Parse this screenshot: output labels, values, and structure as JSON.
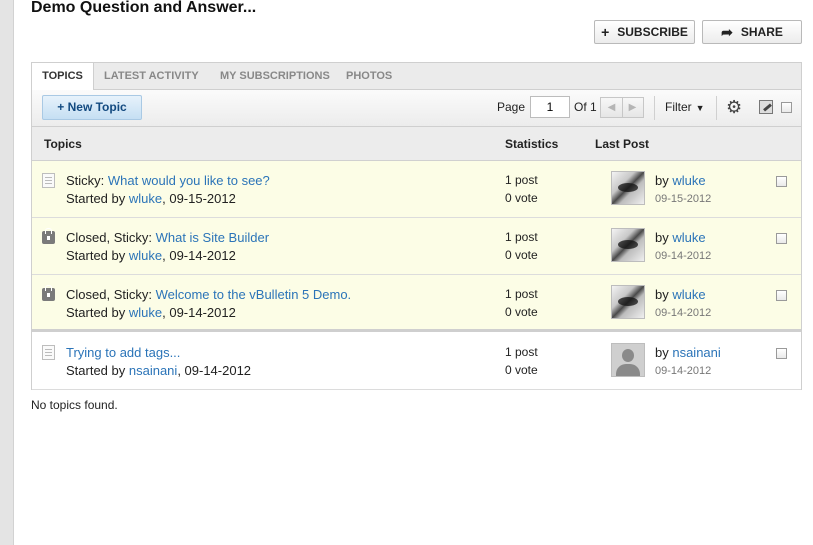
{
  "page": {
    "title": "Demo Question and Answer..."
  },
  "header_buttons": {
    "subscribe": {
      "icon": "plus-icon",
      "glyph": "+",
      "label": "SUBSCRIBE"
    },
    "share": {
      "icon": "share-arrow-icon",
      "glyph": "➦",
      "label": "SHARE"
    }
  },
  "tabs": [
    {
      "label": "TOPICS",
      "active": true
    },
    {
      "label": "LATEST ACTIVITY",
      "active": false
    },
    {
      "label": "MY SUBSCRIPTIONS",
      "active": false
    },
    {
      "label": "PHOTOS",
      "active": false
    }
  ],
  "toolbar": {
    "new_topic": "+ New Topic",
    "page_label": "Page",
    "page_value": "1",
    "of_label": "Of 1",
    "prev_glyph": "◀",
    "next_glyph": "▶",
    "filter_label": "Filter",
    "filter_caret": "▼",
    "gear_glyph": "⚙"
  },
  "columns": {
    "topics": "Topics",
    "statistics": "Statistics",
    "last_post": "Last Post"
  },
  "topics": [
    {
      "prefix": "Sticky: ",
      "title": "What would you like to see?",
      "started_by": "Started by ",
      "author": "wluke",
      "date": ", 09-15-2012",
      "posts": "1 post",
      "votes": "0 vote",
      "lp_by": "by ",
      "lp_user": "wluke",
      "lp_date": "09-15-2012",
      "icon": "document-icon",
      "style": "sticky",
      "avatar": "photo"
    },
    {
      "prefix": "Closed, Sticky: ",
      "title": "What is Site Builder",
      "started_by": "Started by ",
      "author": "wluke",
      "date": ", 09-14-2012",
      "posts": "1 post",
      "votes": "0 vote",
      "lp_by": "by ",
      "lp_user": "wluke",
      "lp_date": "09-14-2012",
      "icon": "lock-icon",
      "style": "sticky",
      "avatar": "photo"
    },
    {
      "prefix": "Closed, Sticky: ",
      "title": "Welcome to the vBulletin 5 Demo.",
      "started_by": "Started by ",
      "author": "wluke",
      "date": ", 09-14-2012",
      "posts": "1 post",
      "votes": "0 vote",
      "lp_by": "by ",
      "lp_user": "wluke",
      "lp_date": "09-14-2012",
      "icon": "lock-icon",
      "style": "sticky",
      "avatar": "photo"
    },
    {
      "prefix": "",
      "title": "Trying to add tags...",
      "started_by": "Started by ",
      "author": "nsainani",
      "date": ", 09-14-2012",
      "posts": "1 post",
      "votes": "0 vote",
      "lp_by": "by ",
      "lp_user": "nsainani",
      "lp_date": "09-14-2012",
      "icon": "document-icon",
      "style": "normal",
      "avatar": "default"
    }
  ],
  "footer": {
    "no_topics": "No topics found."
  }
}
